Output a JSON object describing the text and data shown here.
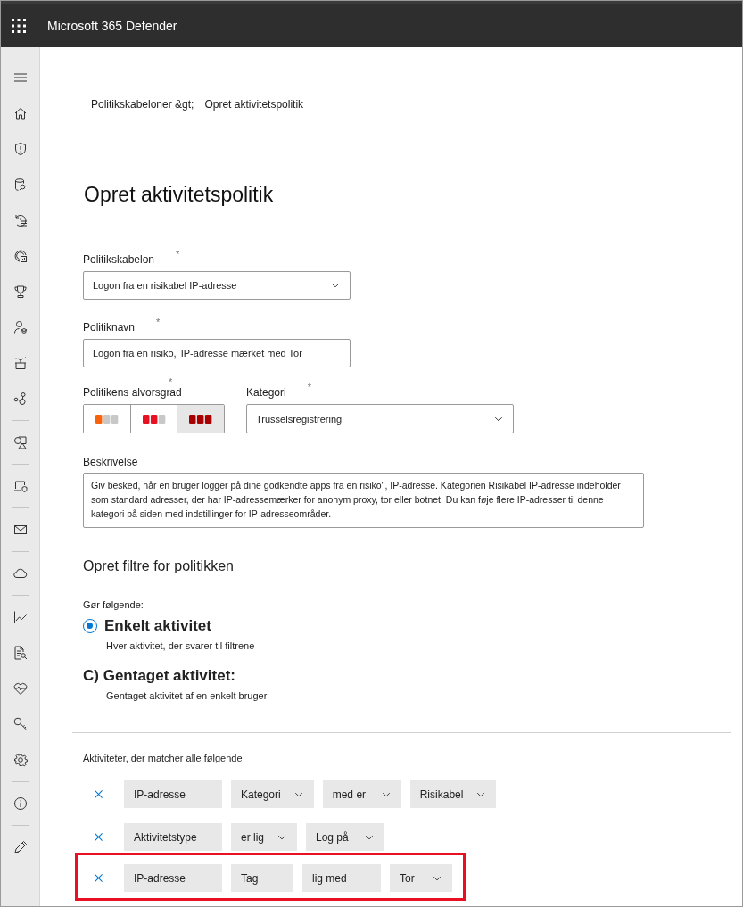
{
  "app": {
    "title": "Microsoft 365 Defender"
  },
  "breadcrumb": [
    "Politikskabeloner &gt;",
    "Opret aktivitetspolitik"
  ],
  "page_title": "Opret aktivitetspolitik",
  "template": {
    "label": "Politikskabelon",
    "required_mark": "*",
    "value": "Logon fra en risikabel IP-adresse"
  },
  "policy_name": {
    "label": "Politiknavn",
    "required_mark": "*",
    "value": "Logon fra en risiko,' IP-adresse mærket med Tor"
  },
  "severity": {
    "label": "Politikens alvorsgrad",
    "required_mark": "*",
    "levels": [
      {
        "kind": "low",
        "selected": false
      },
      {
        "kind": "medium",
        "selected": false
      },
      {
        "kind": "high",
        "selected": true
      }
    ]
  },
  "category": {
    "label": "Kategori",
    "required_mark": "*",
    "value": "Trusselsregistrering"
  },
  "description": {
    "label": "Beskrivelse",
    "value": "Giv besked, når en bruger logger på dine godkendte apps fra en risiko\", IP-adresse. Kategorien Risikabel IP-adresse indeholder som standard adresser, der har IP-adressemærker for anonym proxy, tor eller botnet. Du kan føje flere IP-adresser til denne kategori på siden med indstillinger for IP-adresseområder."
  },
  "filters_heading": "Opret filtre for politikken",
  "act_label": "Gør følgende:",
  "options": [
    {
      "kind": "radio",
      "title": "Enkelt aktivitet",
      "subtitle": "Hver aktivitet, der svarer til filtrene",
      "selected": true
    },
    {
      "kind": "plain",
      "title": "C) Gentaget aktivitet:",
      "subtitle": "Gentaget aktivitet af en enkelt bruger"
    }
  ],
  "match_label": "Aktiviteter, der matcher alle følgende",
  "filter_rows": [
    {
      "highlighted": false,
      "parts": [
        {
          "text": "IP-adresse",
          "dropdown": false
        },
        {
          "text": "Kategori",
          "dropdown": true
        },
        {
          "text": "med er",
          "dropdown": true
        },
        {
          "text": "Risikabel",
          "dropdown": true
        }
      ]
    },
    {
      "highlighted": false,
      "parts": [
        {
          "text": "Aktivitetstype",
          "dropdown": false
        },
        {
          "text": "er lig",
          "dropdown": true
        },
        {
          "text": "Log på",
          "dropdown": true
        }
      ]
    },
    {
      "highlighted": true,
      "parts": [
        {
          "text": "IP-adresse",
          "dropdown": false
        },
        {
          "text": "Tag",
          "dropdown": false
        },
        {
          "text": "lig med",
          "dropdown": false
        },
        {
          "text": "Tor",
          "dropdown": true
        }
      ]
    }
  ]
}
